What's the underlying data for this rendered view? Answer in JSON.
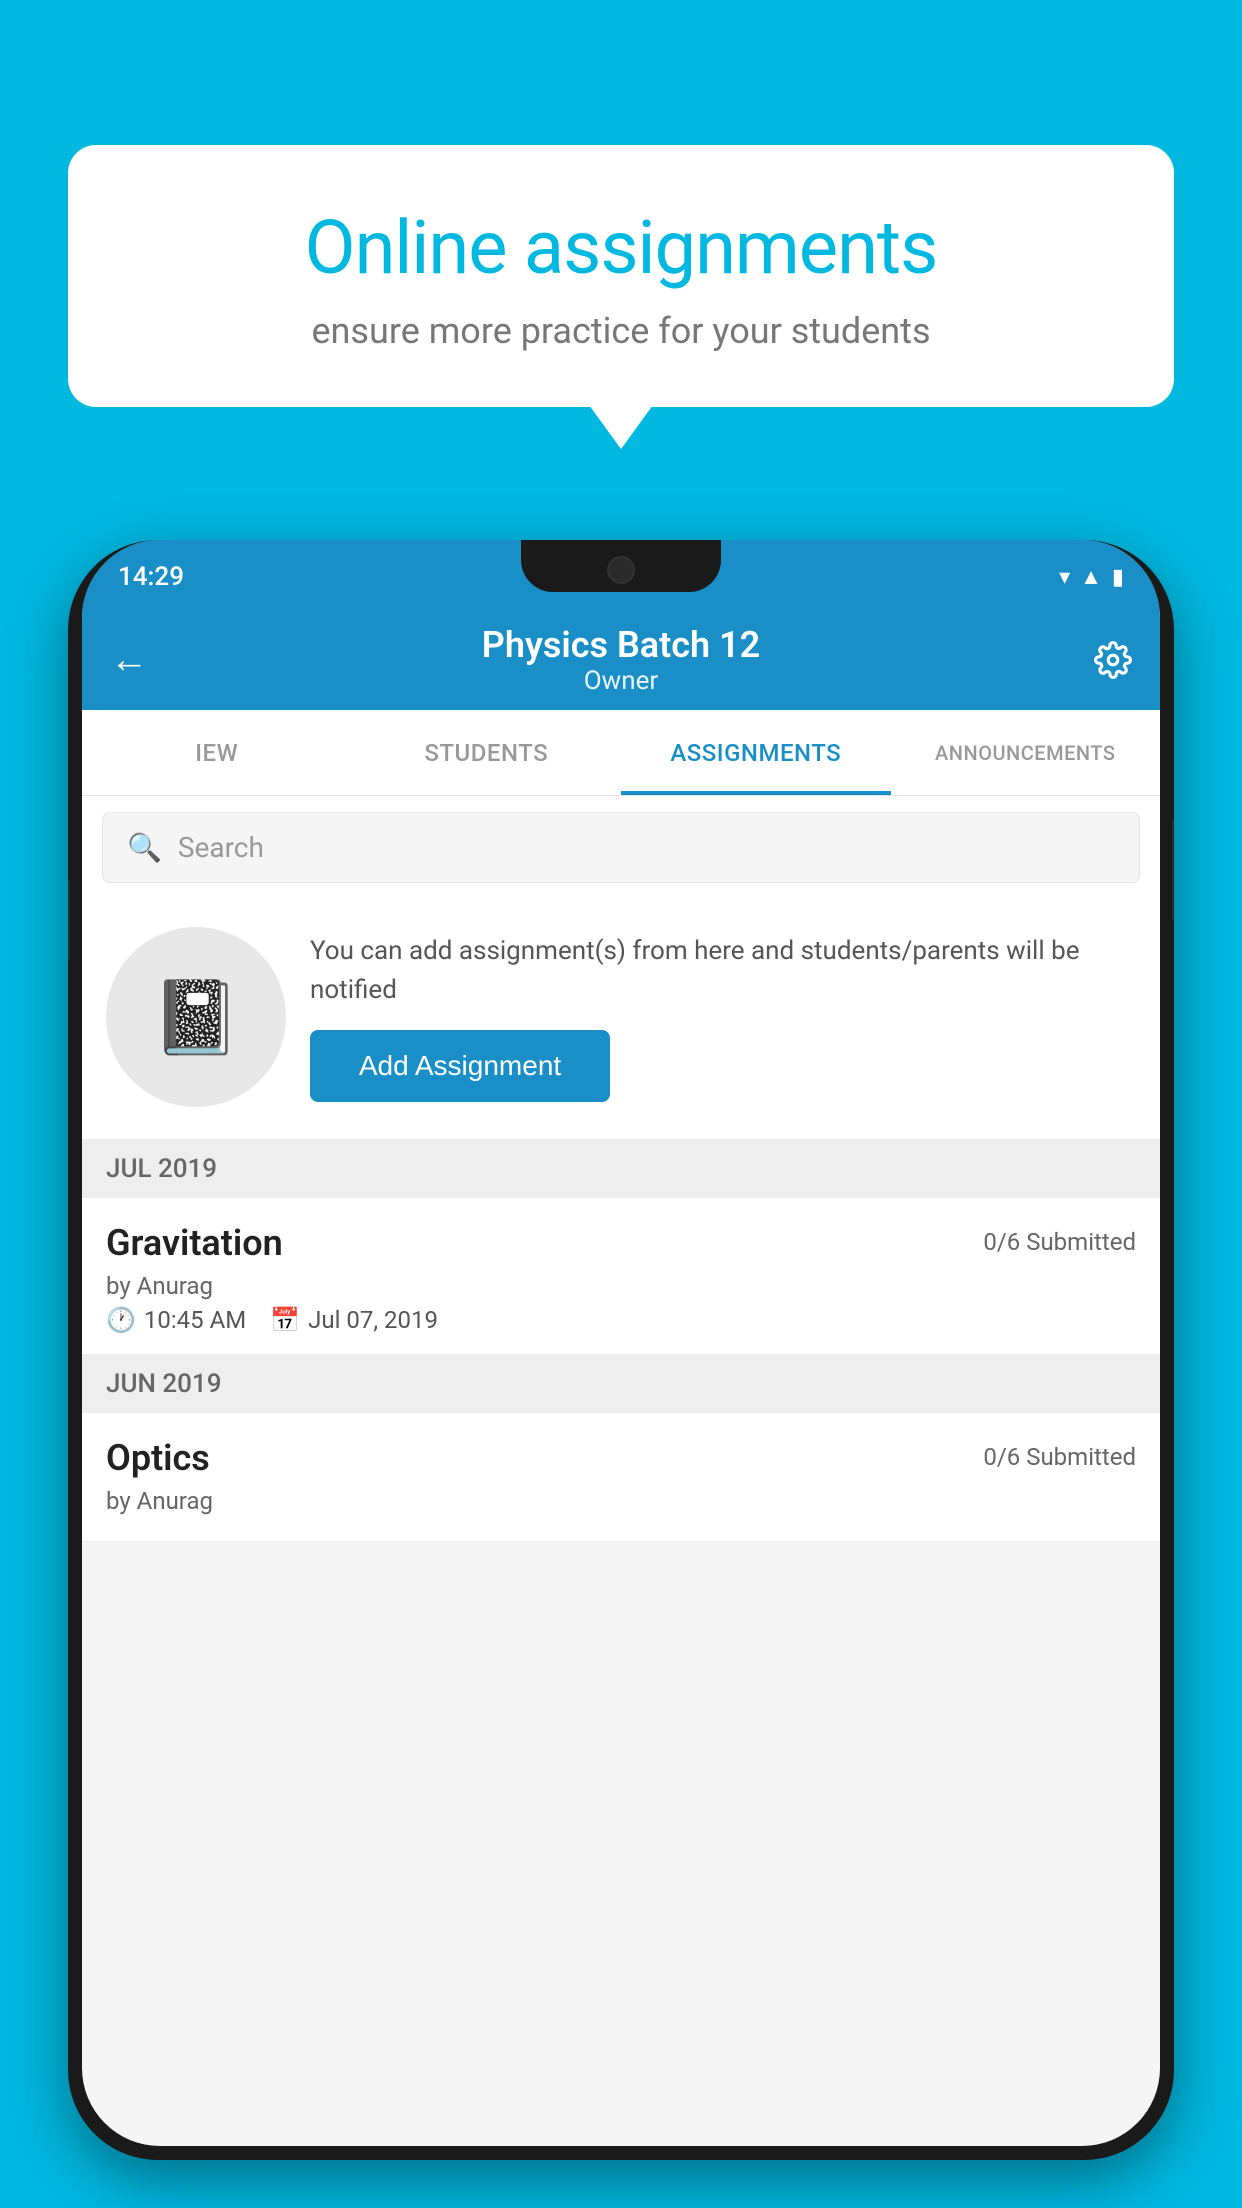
{
  "background_color": "#00B8E0",
  "speech_bubble": {
    "headline": "Online assignments",
    "subtext": "ensure more practice for your students"
  },
  "phone": {
    "status_bar": {
      "time": "14:29",
      "icons": [
        "wifi",
        "signal",
        "battery"
      ]
    },
    "header": {
      "title": "Physics Batch 12",
      "subtitle": "Owner",
      "back_label": "←",
      "settings_label": "⚙"
    },
    "tabs": [
      {
        "label": "IEW",
        "active": false
      },
      {
        "label": "STUDENTS",
        "active": false
      },
      {
        "label": "ASSIGNMENTS",
        "active": true
      },
      {
        "label": "ANNOUNCEMENTS",
        "active": false
      }
    ],
    "search": {
      "placeholder": "Search"
    },
    "empty_state": {
      "description": "You can add assignment(s) from here and students/parents will be notified",
      "button_label": "Add Assignment"
    },
    "sections": [
      {
        "label": "JUL 2019",
        "assignments": [
          {
            "name": "Gravitation",
            "submitted": "0/6 Submitted",
            "by": "by Anurag",
            "time": "10:45 AM",
            "date": "Jul 07, 2019"
          }
        ]
      },
      {
        "label": "JUN 2019",
        "assignments": [
          {
            "name": "Optics",
            "submitted": "0/6 Submitted",
            "by": "by Anurag",
            "time": "",
            "date": ""
          }
        ]
      }
    ]
  }
}
